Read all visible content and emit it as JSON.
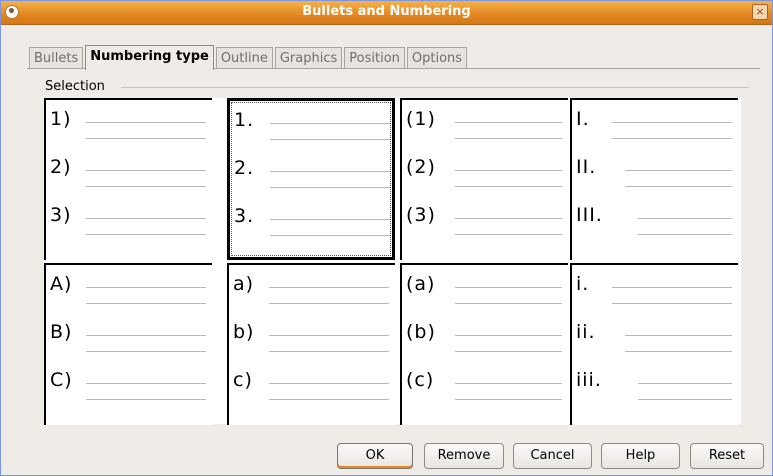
{
  "window": {
    "title": "Bullets and Numbering",
    "close_glyph": "×"
  },
  "tabs": [
    {
      "label": "Bullets",
      "active": false
    },
    {
      "label": "Numbering type",
      "active": true
    },
    {
      "label": "Outline",
      "active": false
    },
    {
      "label": "Graphics",
      "active": false
    },
    {
      "label": "Position",
      "active": false
    },
    {
      "label": "Options",
      "active": false
    }
  ],
  "selection": {
    "label": "Selection",
    "styles": [
      {
        "items": [
          "1)",
          "2)",
          "3)"
        ],
        "selected": false
      },
      {
        "items": [
          "1.",
          "2.",
          "3."
        ],
        "selected": true
      },
      {
        "items": [
          "(1)",
          "(2)",
          "(3)"
        ],
        "selected": false
      },
      {
        "items": [
          "I.",
          "II.",
          "III."
        ],
        "selected": false
      },
      {
        "items": [
          "A)",
          "B)",
          "C)"
        ],
        "selected": false
      },
      {
        "items": [
          "a)",
          "b)",
          "c)"
        ],
        "selected": false
      },
      {
        "items": [
          "(a)",
          "(b)",
          "(c)"
        ],
        "selected": false
      },
      {
        "items": [
          "i.",
          "ii.",
          "iii."
        ],
        "selected": false
      }
    ]
  },
  "buttons": {
    "ok": "OK",
    "remove": "Remove",
    "cancel": "Cancel",
    "help": "Help",
    "reset": "Reset"
  }
}
